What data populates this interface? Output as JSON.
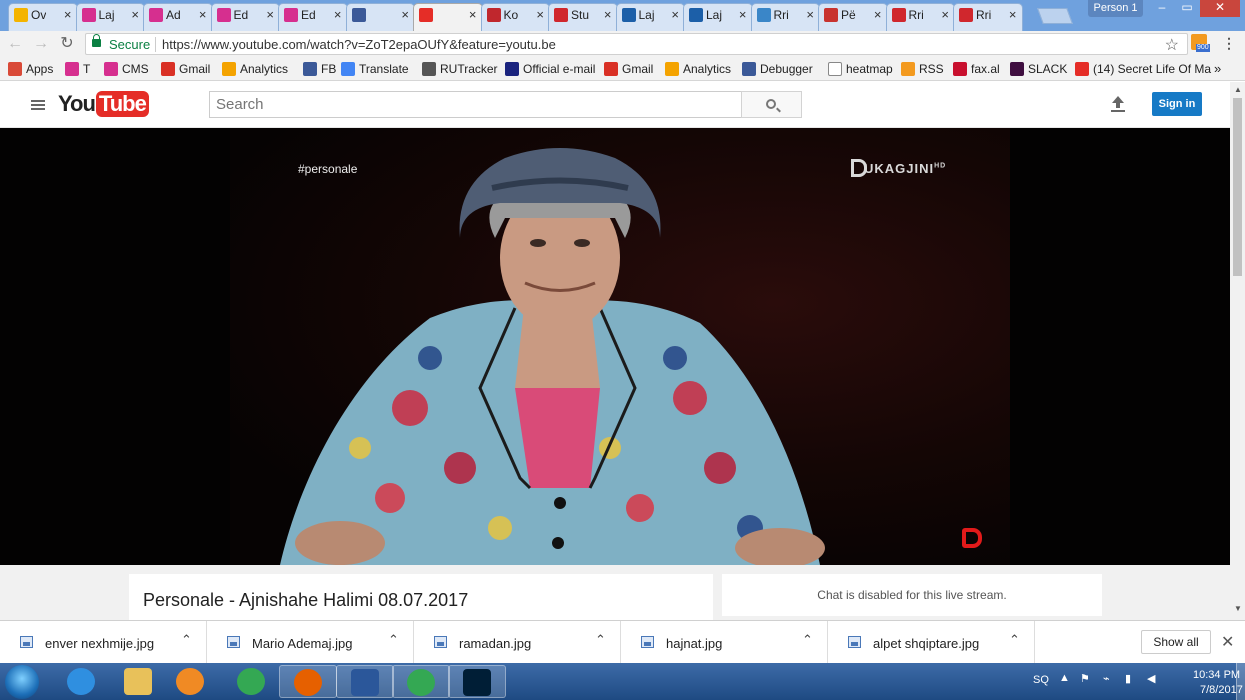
{
  "browser": {
    "tabs": [
      {
        "label": "Ov",
        "favicon_color": "#f4b400"
      },
      {
        "label": "Laj",
        "favicon_color": "#d62f8f"
      },
      {
        "label": "Ad",
        "favicon_color": "#d62f8f"
      },
      {
        "label": "Ed",
        "favicon_color": "#d62f8f"
      },
      {
        "label": "Ed",
        "favicon_color": "#d62f8f"
      },
      {
        "label": "",
        "favicon_color": "#3b5998"
      },
      {
        "label": "",
        "favicon_color": "#e52d27"
      },
      {
        "label": "Ko",
        "favicon_color": "#c0272d"
      },
      {
        "label": "Stu",
        "favicon_color": "#d0272d"
      },
      {
        "label": "Laj",
        "favicon_color": "#1c5fa8"
      },
      {
        "label": "Laj",
        "favicon_color": "#1c5fa8"
      },
      {
        "label": "Rri",
        "favicon_color": "#3a86c8"
      },
      {
        "label": "Pë",
        "favicon_color": "#c8332f"
      },
      {
        "label": "Rri",
        "favicon_color": "#d0272d"
      },
      {
        "label": "Rri",
        "favicon_color": "#d0272d"
      }
    ],
    "profile_name": "Person 1",
    "secure_label": "Secure",
    "url": "https://www.youtube.com/watch?v=ZoT2epaOUfY&feature=youtu.be",
    "rss_badge": "900",
    "bookmarks": [
      {
        "label": "Apps",
        "icon_color": "#d94a38"
      },
      {
        "label": "T",
        "icon_color": "#d62f8f"
      },
      {
        "label": "CMS",
        "icon_color": "#d62f8f"
      },
      {
        "label": "Gmail",
        "icon_color": "#d93025"
      },
      {
        "label": "Analytics",
        "icon_color": "#f4a300"
      },
      {
        "label": "FB",
        "icon_color": "#3b5998"
      },
      {
        "label": "Translate",
        "icon_color": "#4285f4"
      },
      {
        "label": "RUTracker",
        "icon_color": "#555555"
      },
      {
        "label": "Official e-mail",
        "icon_color": "#1a237e"
      },
      {
        "label": "Gmail",
        "icon_color": "#d93025"
      },
      {
        "label": "Analytics",
        "icon_color": "#f4a300"
      },
      {
        "label": "Debugger",
        "icon_color": "#3b5998"
      },
      {
        "label": "heatmap",
        "icon_color": "#ffffff"
      },
      {
        "label": "RSS",
        "icon_color": "#f39a1f"
      },
      {
        "label": "fax.al",
        "icon_color": "#c8102e"
      },
      {
        "label": "SLACK",
        "icon_color": "#3f0e40"
      },
      {
        "label": "(14) Secret Life Of Ma",
        "icon_color": "#e52d27"
      }
    ]
  },
  "youtube": {
    "logo_you": "You",
    "logo_tube": "Tube",
    "search_placeholder": "Search",
    "signin_label": "Sign in",
    "video_overlay_hashtag": "#personale",
    "channel_logo": "UKAGJINI",
    "channel_logo_sup": "HD",
    "video_title": "Personale - Ajnishahe Halimi 08.07.2017",
    "chat_message": "Chat is disabled for this live stream."
  },
  "downloads": {
    "items": [
      "enver nexhmije.jpg",
      "Mario Ademaj.jpg",
      "ramadan.jpg",
      "hajnat.jpg",
      "alpet shqiptare.jpg"
    ],
    "show_all": "Show all"
  },
  "taskbar": {
    "apps": [
      {
        "name": "internet-explorer-icon",
        "color": "#2f8fe0",
        "active": false
      },
      {
        "name": "file-explorer-icon",
        "color": "#e8c15a",
        "active": false
      },
      {
        "name": "media-player-icon",
        "color": "#f08a24",
        "active": false
      },
      {
        "name": "chrome-icon",
        "color": "#34a853",
        "active": false
      },
      {
        "name": "firefox-icon",
        "color": "#e66000",
        "active": true
      },
      {
        "name": "word-icon",
        "color": "#2b579a",
        "active": true
      },
      {
        "name": "chrome-icon",
        "color": "#34a853",
        "active": true
      },
      {
        "name": "photoshop-icon",
        "color": "#001e36",
        "active": true
      }
    ],
    "language": "SQ",
    "time": "10:34 PM",
    "date": "7/8/2017"
  }
}
